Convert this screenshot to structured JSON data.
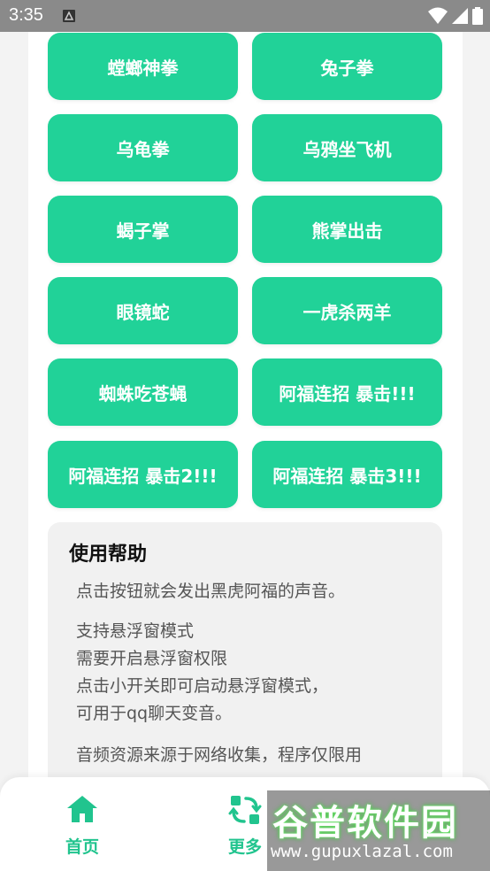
{
  "statusbar": {
    "time": "3:35"
  },
  "buttons": [
    {
      "label": ""
    },
    {
      "label": ""
    },
    {
      "label": "螳螂神拳"
    },
    {
      "label": "兔子拳"
    },
    {
      "label": "乌龟拳"
    },
    {
      "label": "乌鸦坐飞机"
    },
    {
      "label": "蝎子掌"
    },
    {
      "label": "熊掌出击"
    },
    {
      "label": "眼镜蛇"
    },
    {
      "label": "一虎杀两羊"
    },
    {
      "label": "蜘蛛吃苍蝇"
    },
    {
      "label": "阿福连招 暴击!!!"
    },
    {
      "label": "阿福连招 暴击2!!!"
    },
    {
      "label": "阿福连招 暴击3!!!"
    }
  ],
  "help": {
    "title": "使用帮助",
    "p1": "点击按钮就会发出黑虎阿福的声音。",
    "p2_l1": "支持悬浮窗模式",
    "p2_l2": "需要开启悬浮窗权限",
    "p2_l3": "点击小开关即可启动悬浮窗模式，",
    "p2_l4": "可用于qq聊天变音。",
    "p3": "音频资源来源于网络收集，程序仅限用"
  },
  "nav": {
    "home": "首页",
    "more": "更多"
  },
  "watermark": {
    "title": "谷普软件园",
    "url": "www.gupuxlazal.com"
  },
  "colors": {
    "accent": "#21d298",
    "nav_accent": "#21c48e"
  },
  "icons": [
    "home-icon",
    "refresh-icon",
    "wifi-icon",
    "signal-icon",
    "battery-icon"
  ]
}
